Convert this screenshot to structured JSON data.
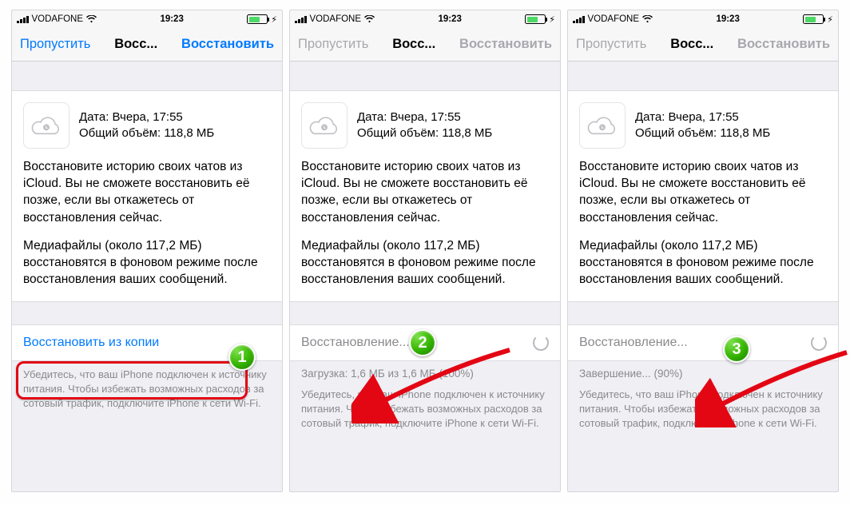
{
  "status": {
    "carrier": "VODAFONE",
    "time": "19:23"
  },
  "nav": {
    "skip": "Пропустить",
    "title": "Восс...",
    "restore": "Восстановить"
  },
  "info": {
    "date_label": "Дата: Вчера, 17:55",
    "size_label": "Общий объём: 118,8 МБ",
    "para1": "Восстановите историю своих чатов из iCloud. Вы не сможете восстановить её позже, если вы откажетесь от восстановления сейчас.",
    "para2": "Медиафайлы (около 117,2 МБ) восстановятся в фоновом режиме после восстановления ваших сообщений."
  },
  "foot": "Убедитесь, что ваш iPhone подключен к источнику питания. Чтобы избежать возможных расходов за сотовый трафик, подключите iPhone к сети Wi-Fi.",
  "screens": {
    "s1": {
      "action": "Восстановить из копии"
    },
    "s2": {
      "action": "Восстановление...",
      "progress": "Загрузка: 1,6 МБ из 1,6 МБ (100%)"
    },
    "s3": {
      "action": "Восстановление...",
      "progress": "Завершение... (90%)"
    }
  },
  "badges": {
    "b1": "1",
    "b2": "2",
    "b3": "3"
  }
}
